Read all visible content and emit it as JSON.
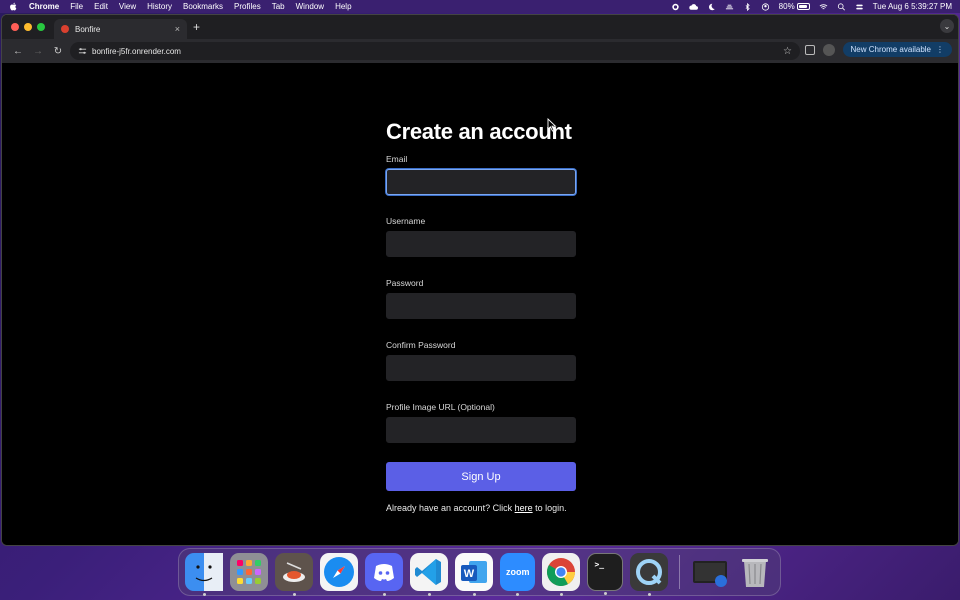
{
  "menubar": {
    "app_name": "Chrome",
    "items": [
      "File",
      "Edit",
      "View",
      "History",
      "Bookmarks",
      "Profiles",
      "Tab",
      "Window",
      "Help"
    ],
    "battery": "80%",
    "datetime": "Tue Aug 6  5:39:27 PM"
  },
  "browser": {
    "tab_title": "Bonfire",
    "tab_close": "×",
    "new_tab": "+",
    "url": "bonfire-j5fr.onrender.com",
    "update_label": "New Chrome available",
    "update_menu": "⋮",
    "back": "←",
    "forward": "→",
    "reload": "↻",
    "star": "☆",
    "tab_search": "⌄"
  },
  "form": {
    "title": "Create an account",
    "email_label": "Email",
    "email_value": "",
    "username_label": "Username",
    "username_value": "",
    "password_label": "Password",
    "password_value": "",
    "confirm_label": "Confirm Password",
    "confirm_value": "",
    "profile_label": "Profile Image URL (Optional)",
    "profile_value": "",
    "submit_label": "Sign Up",
    "login_prefix": "Already have an account? Click ",
    "login_link": "here",
    "login_suffix": " to login."
  },
  "dock": {
    "apps": [
      {
        "name": "finder-icon",
        "color": "#3c8ef0"
      },
      {
        "name": "launchpad-icon",
        "color": "#8a8a8a"
      },
      {
        "name": "bonfire-app-icon",
        "color": "#6b5a4a"
      },
      {
        "name": "safari-icon",
        "color": "#2a8cf0"
      },
      {
        "name": "discord-icon",
        "color": "#5865f2"
      },
      {
        "name": "vscode-icon",
        "color": "#23a0e8"
      },
      {
        "name": "word-icon",
        "color": "#1f5bbf"
      },
      {
        "name": "zoom-icon",
        "color": "#2d8cff"
      },
      {
        "name": "chrome-icon",
        "color": "#f2f2f2"
      },
      {
        "name": "terminal-icon",
        "color": "#1e1e1e"
      },
      {
        "name": "quicktime-icon",
        "color": "#3a3a3a"
      }
    ],
    "zoom_label": "zoom",
    "word_label": "W",
    "terminal_label": ">_",
    "extras": [
      {
        "name": "preview-window-icon",
        "color": "#2a2a2a"
      },
      {
        "name": "trash-icon",
        "color": "#9a9a9a"
      }
    ]
  }
}
